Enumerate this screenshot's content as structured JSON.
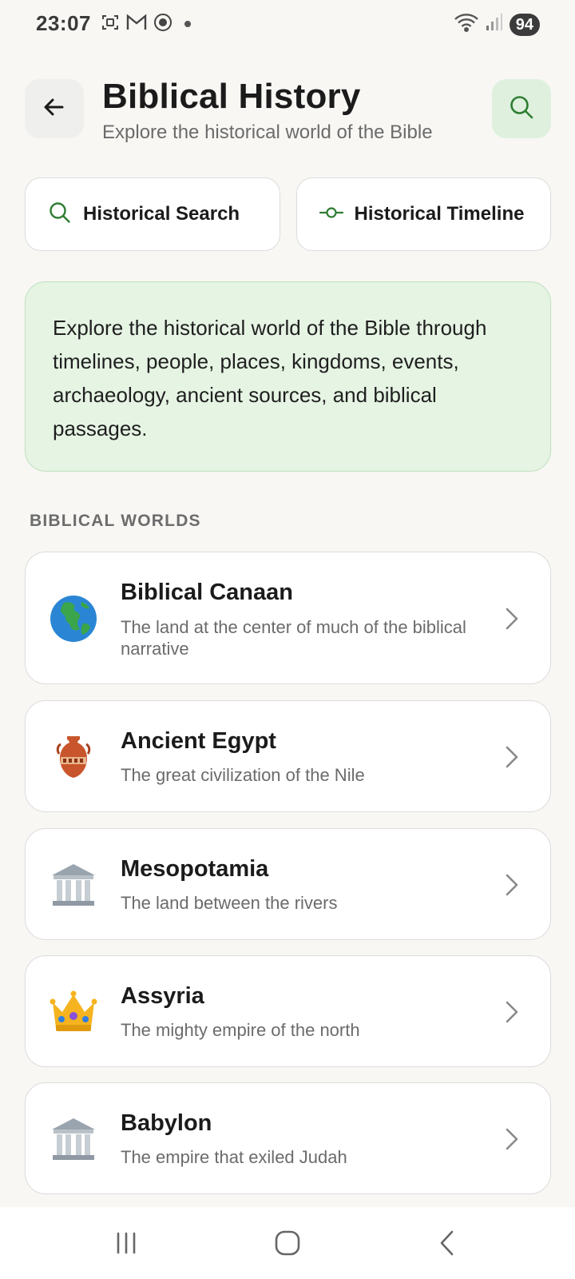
{
  "status": {
    "time": "23:07",
    "battery": "94",
    "left_icons": [
      "screenshot-icon",
      "gmail-icon",
      "record-icon",
      "dot-icon"
    ],
    "right_icons": [
      "wifi-icon",
      "signal-icon"
    ]
  },
  "header": {
    "title": "Biblical History",
    "subtitle": "Explore the historical world of the Bible"
  },
  "quick_actions": [
    {
      "label": "Historical Search",
      "icon": "search-icon"
    },
    {
      "label": "Historical Timeline",
      "icon": "timeline-icon"
    }
  ],
  "intro": {
    "text": "Explore the historical world of the Bible through timelines, people, places, kingdoms, events, archaeology, ancient sources, and biblical passages."
  },
  "section": {
    "title": "BIBLICAL WORLDS"
  },
  "worlds": [
    {
      "name": "Biblical Canaan",
      "description": "The land at the center of much of the biblical narrative",
      "icon": "globe-icon"
    },
    {
      "name": "Ancient Egypt",
      "description": "The great civilization of the Nile",
      "icon": "amphora-icon"
    },
    {
      "name": "Mesopotamia",
      "description": "The land between the rivers",
      "icon": "classical-building-icon"
    },
    {
      "name": "Assyria",
      "description": "The mighty empire of the north",
      "icon": "crown-icon"
    },
    {
      "name": "Babylon",
      "description": "The empire that exiled Judah",
      "icon": "classical-building-icon"
    }
  ],
  "colors": {
    "accent": "#2e7d32",
    "accent_bg": "#dff1de",
    "intro_bg": "#e6f4e4",
    "background": "#f8f7f4"
  },
  "nav": {
    "buttons": [
      "recent-apps-icon",
      "home-icon",
      "back-nav-icon"
    ]
  }
}
